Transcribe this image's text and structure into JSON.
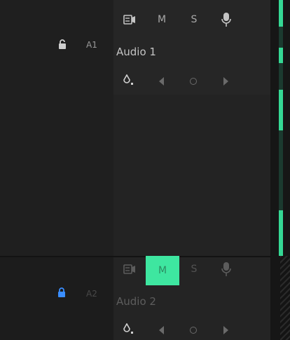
{
  "tracks": [
    {
      "id": "A1",
      "name": "Audio 1",
      "locked": false,
      "mute_label": "M",
      "solo_label": "S",
      "mute_active": false
    },
    {
      "id": "A2",
      "name": "Audio 2",
      "locked": true,
      "mute_label": "M",
      "solo_label": "S",
      "mute_active": true
    }
  ],
  "colors": {
    "accent_green": "#3ee6a0",
    "lock_blue": "#3a8eff",
    "panel_bg": "#1e1e1e"
  },
  "icons": {
    "voiceover": "camera-record-icon",
    "mic": "microphone-icon",
    "lock": "lock-icon",
    "keyframe_add": "keyframe-pen-icon",
    "prev_keyframe": "chevron-left-icon",
    "add_keyframe": "diamond-icon",
    "next_keyframe": "chevron-right-icon"
  }
}
